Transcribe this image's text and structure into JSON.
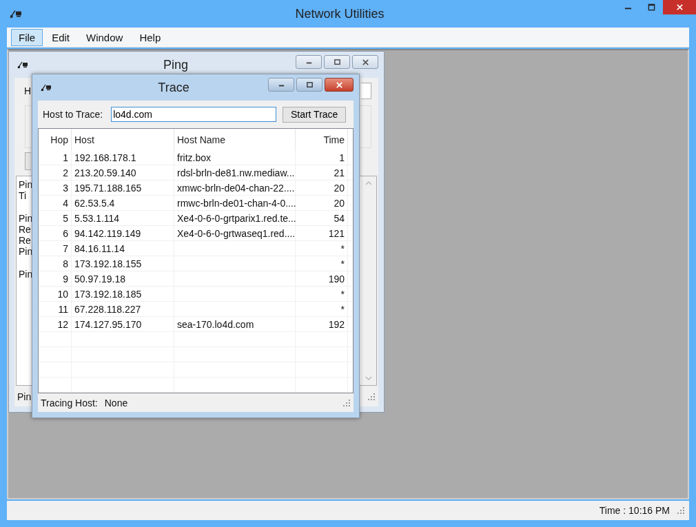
{
  "window": {
    "title": "Network Utilities"
  },
  "menu": [
    {
      "label": "File",
      "selected": true
    },
    {
      "label": "Edit",
      "selected": false
    },
    {
      "label": "Window",
      "selected": false
    },
    {
      "label": "Help",
      "selected": false
    }
  ],
  "ping_window": {
    "title": "Ping",
    "host_label": "H",
    "log_blocks": [
      {
        "lines": [
          "Pin",
          "Ti"
        ]
      },
      {
        "lines": [
          "Pin",
          "Re",
          "Re",
          "Pin"
        ]
      },
      {
        "lines": [
          "Pin"
        ]
      }
    ],
    "status": "Pin"
  },
  "trace_window": {
    "title": "Trace",
    "host_label": "Host to Trace:",
    "host_value": "lo4d.com",
    "button": "Start Trace",
    "columns": [
      "Hop",
      "Host",
      "Host Name",
      "Time"
    ],
    "rows": [
      {
        "hop": "1",
        "host": "192.168.178.1",
        "host_name": "fritz.box",
        "time": "1"
      },
      {
        "hop": "2",
        "host": "213.20.59.140",
        "host_name": "rdsl-brln-de81.nw.mediaw...",
        "time": "21"
      },
      {
        "hop": "3",
        "host": "195.71.188.165",
        "host_name": "xmwc-brln-de04-chan-22....",
        "time": "20"
      },
      {
        "hop": "4",
        "host": "62.53.5.4",
        "host_name": "rmwc-brln-de01-chan-4-0....",
        "time": "20"
      },
      {
        "hop": "5",
        "host": "5.53.1.114",
        "host_name": "Xe4-0-6-0-grtparix1.red.te...",
        "time": "54"
      },
      {
        "hop": "6",
        "host": "94.142.119.149",
        "host_name": "Xe4-0-6-0-grtwaseq1.red....",
        "time": "121"
      },
      {
        "hop": "7",
        "host": "84.16.11.14",
        "time": "*"
      },
      {
        "hop": "8",
        "host": "173.192.18.155",
        "time": "*"
      },
      {
        "hop": "9",
        "host": "50.97.19.18",
        "time": "190"
      },
      {
        "hop": "10",
        "host": "173.192.18.185",
        "time": "*"
      },
      {
        "hop": "11",
        "host": "67.228.118.227",
        "time": "*"
      },
      {
        "hop": "12",
        "host": "174.127.95.170",
        "host_name": "sea-170.lo4d.com",
        "time": "192"
      }
    ],
    "status_label": "Tracing Host:",
    "status_value": "None"
  },
  "status_bar": {
    "time": "Time : 10:16 PM"
  }
}
